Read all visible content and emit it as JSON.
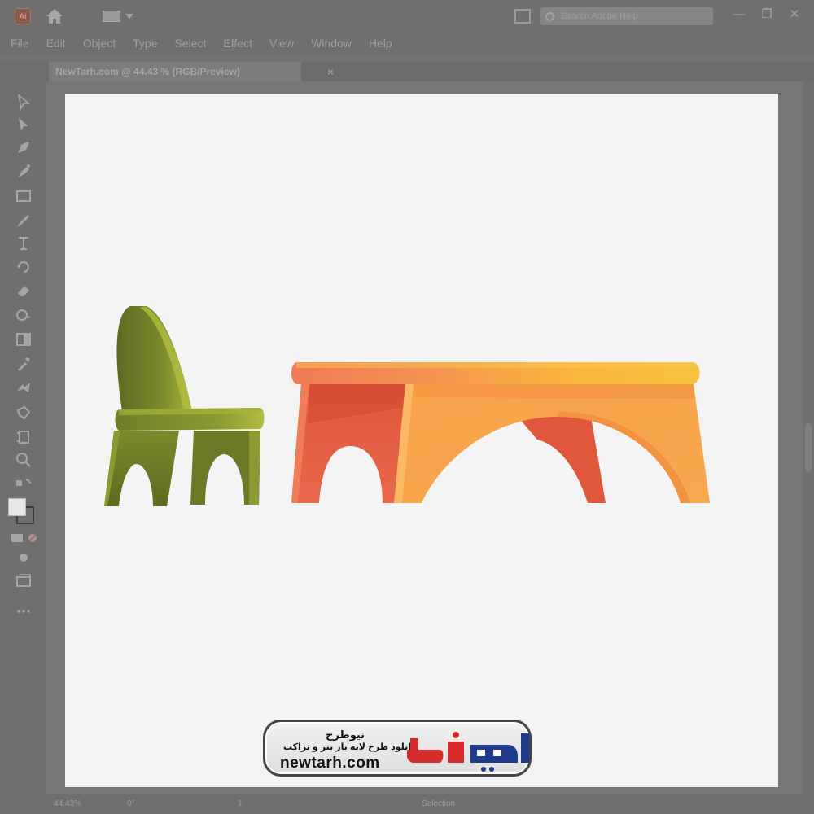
{
  "app": {
    "logo_text": "Ai",
    "search_placeholder": "Search Adobe Help",
    "window_controls": {
      "minimize": "—",
      "restore": "❐",
      "close": "✕"
    }
  },
  "menu": [
    "File",
    "Edit",
    "Object",
    "Type",
    "Select",
    "Effect",
    "View",
    "Window",
    "Help"
  ],
  "document_tab": {
    "title": "NewTarh.com @ 44.43 % (RGB/Preview)",
    "close_glyph": "×"
  },
  "tools": [
    "selection-tool-icon",
    "direct-selection-tool-icon",
    "pen-tool-icon",
    "curvature-tool-icon",
    "rectangle-tool-icon",
    "paintbrush-tool-icon",
    "type-tool-icon",
    "rotate-tool-icon",
    "eraser-tool-icon",
    "shape-builder-tool-icon",
    "gradient-tool-icon",
    "eyedropper-tool-icon",
    "blend-tool-icon",
    "symbol-sprayer-tool-icon",
    "artboard-tool-icon",
    "zoom-tool-icon"
  ],
  "status": {
    "zoom": "44.43%",
    "rotation": "0°",
    "page": "1",
    "active_tool": "Selection"
  },
  "illustration": {
    "chair_colors": [
      "#6f7d2a",
      "#8c9a32",
      "#aab53a",
      "#5d6b22"
    ],
    "table_colors": [
      "#f07a55",
      "#e0573d",
      "#f8a24a",
      "#fbb63c",
      "#f6c33d"
    ]
  },
  "watermark": {
    "brand_name": "نیوطرح",
    "tagline": "دانلود طرح لایه باز بنر و تراکت",
    "domain": "newtarh.com",
    "logo_text": "نیوطرح",
    "colors": {
      "blue": "#1e3a8a",
      "red": "#d72a2a"
    }
  }
}
